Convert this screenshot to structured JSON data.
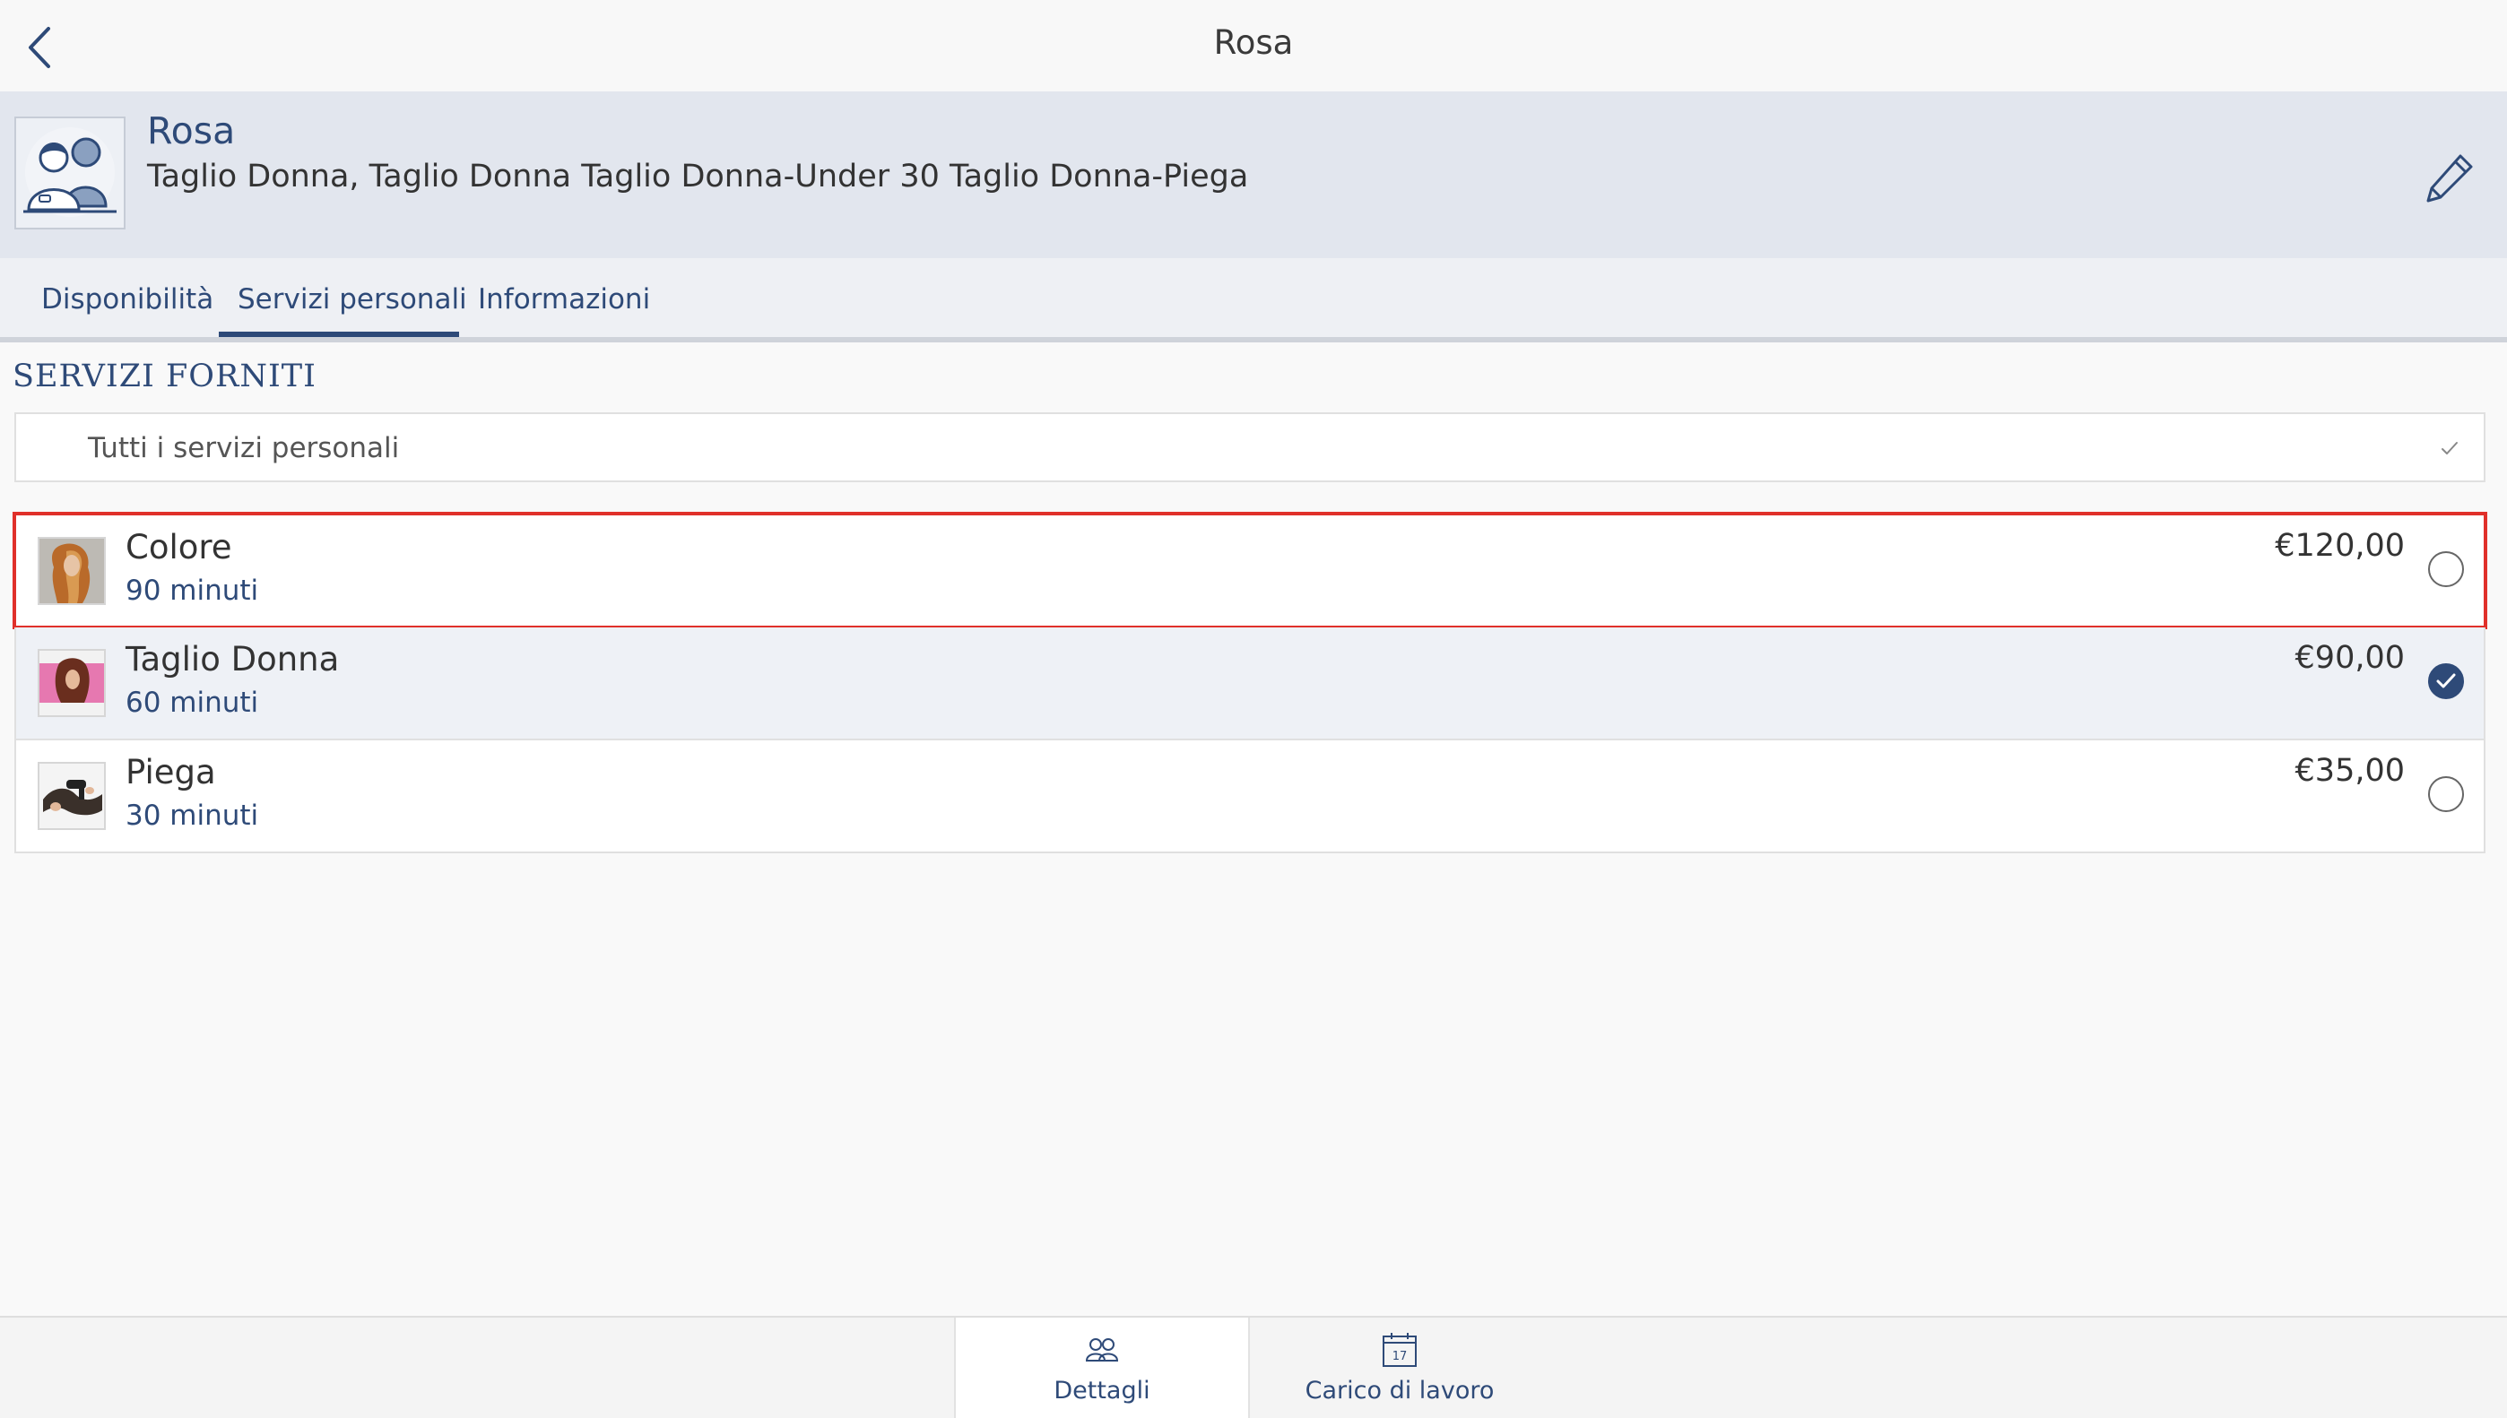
{
  "nav": {
    "title": "Rosa"
  },
  "profile": {
    "name": "Rosa",
    "services_summary": "Taglio Donna, Taglio Donna Taglio Donna-Under 30 Taglio Donna-Piega"
  },
  "tabs": [
    {
      "label": "Disponibilità"
    },
    {
      "label": "Servizi personali",
      "active": true
    },
    {
      "label": "Informazioni"
    }
  ],
  "section": {
    "title": "SERVIZI FORNITI",
    "all_services_label": "Tutti i servizi personali"
  },
  "services": [
    {
      "name": "Colore",
      "duration": "90 minuti",
      "price": "€120,00",
      "selected": false
    },
    {
      "name": "Taglio Donna",
      "duration": "60 minuti",
      "price": "€90,00",
      "selected": true
    },
    {
      "name": "Piega",
      "duration": "30 minuti",
      "price": "€35,00",
      "selected": false
    }
  ],
  "bottom_tabs": [
    {
      "label": "Dettagli",
      "icon": "people-icon",
      "active": true
    },
    {
      "label": "Carico di lavoro",
      "icon": "calendar-icon",
      "calendar_day": "17"
    }
  ],
  "colors": {
    "accent": "#2e4a78",
    "highlight": "#e0302a",
    "header_bg": "#e2e6ee"
  }
}
